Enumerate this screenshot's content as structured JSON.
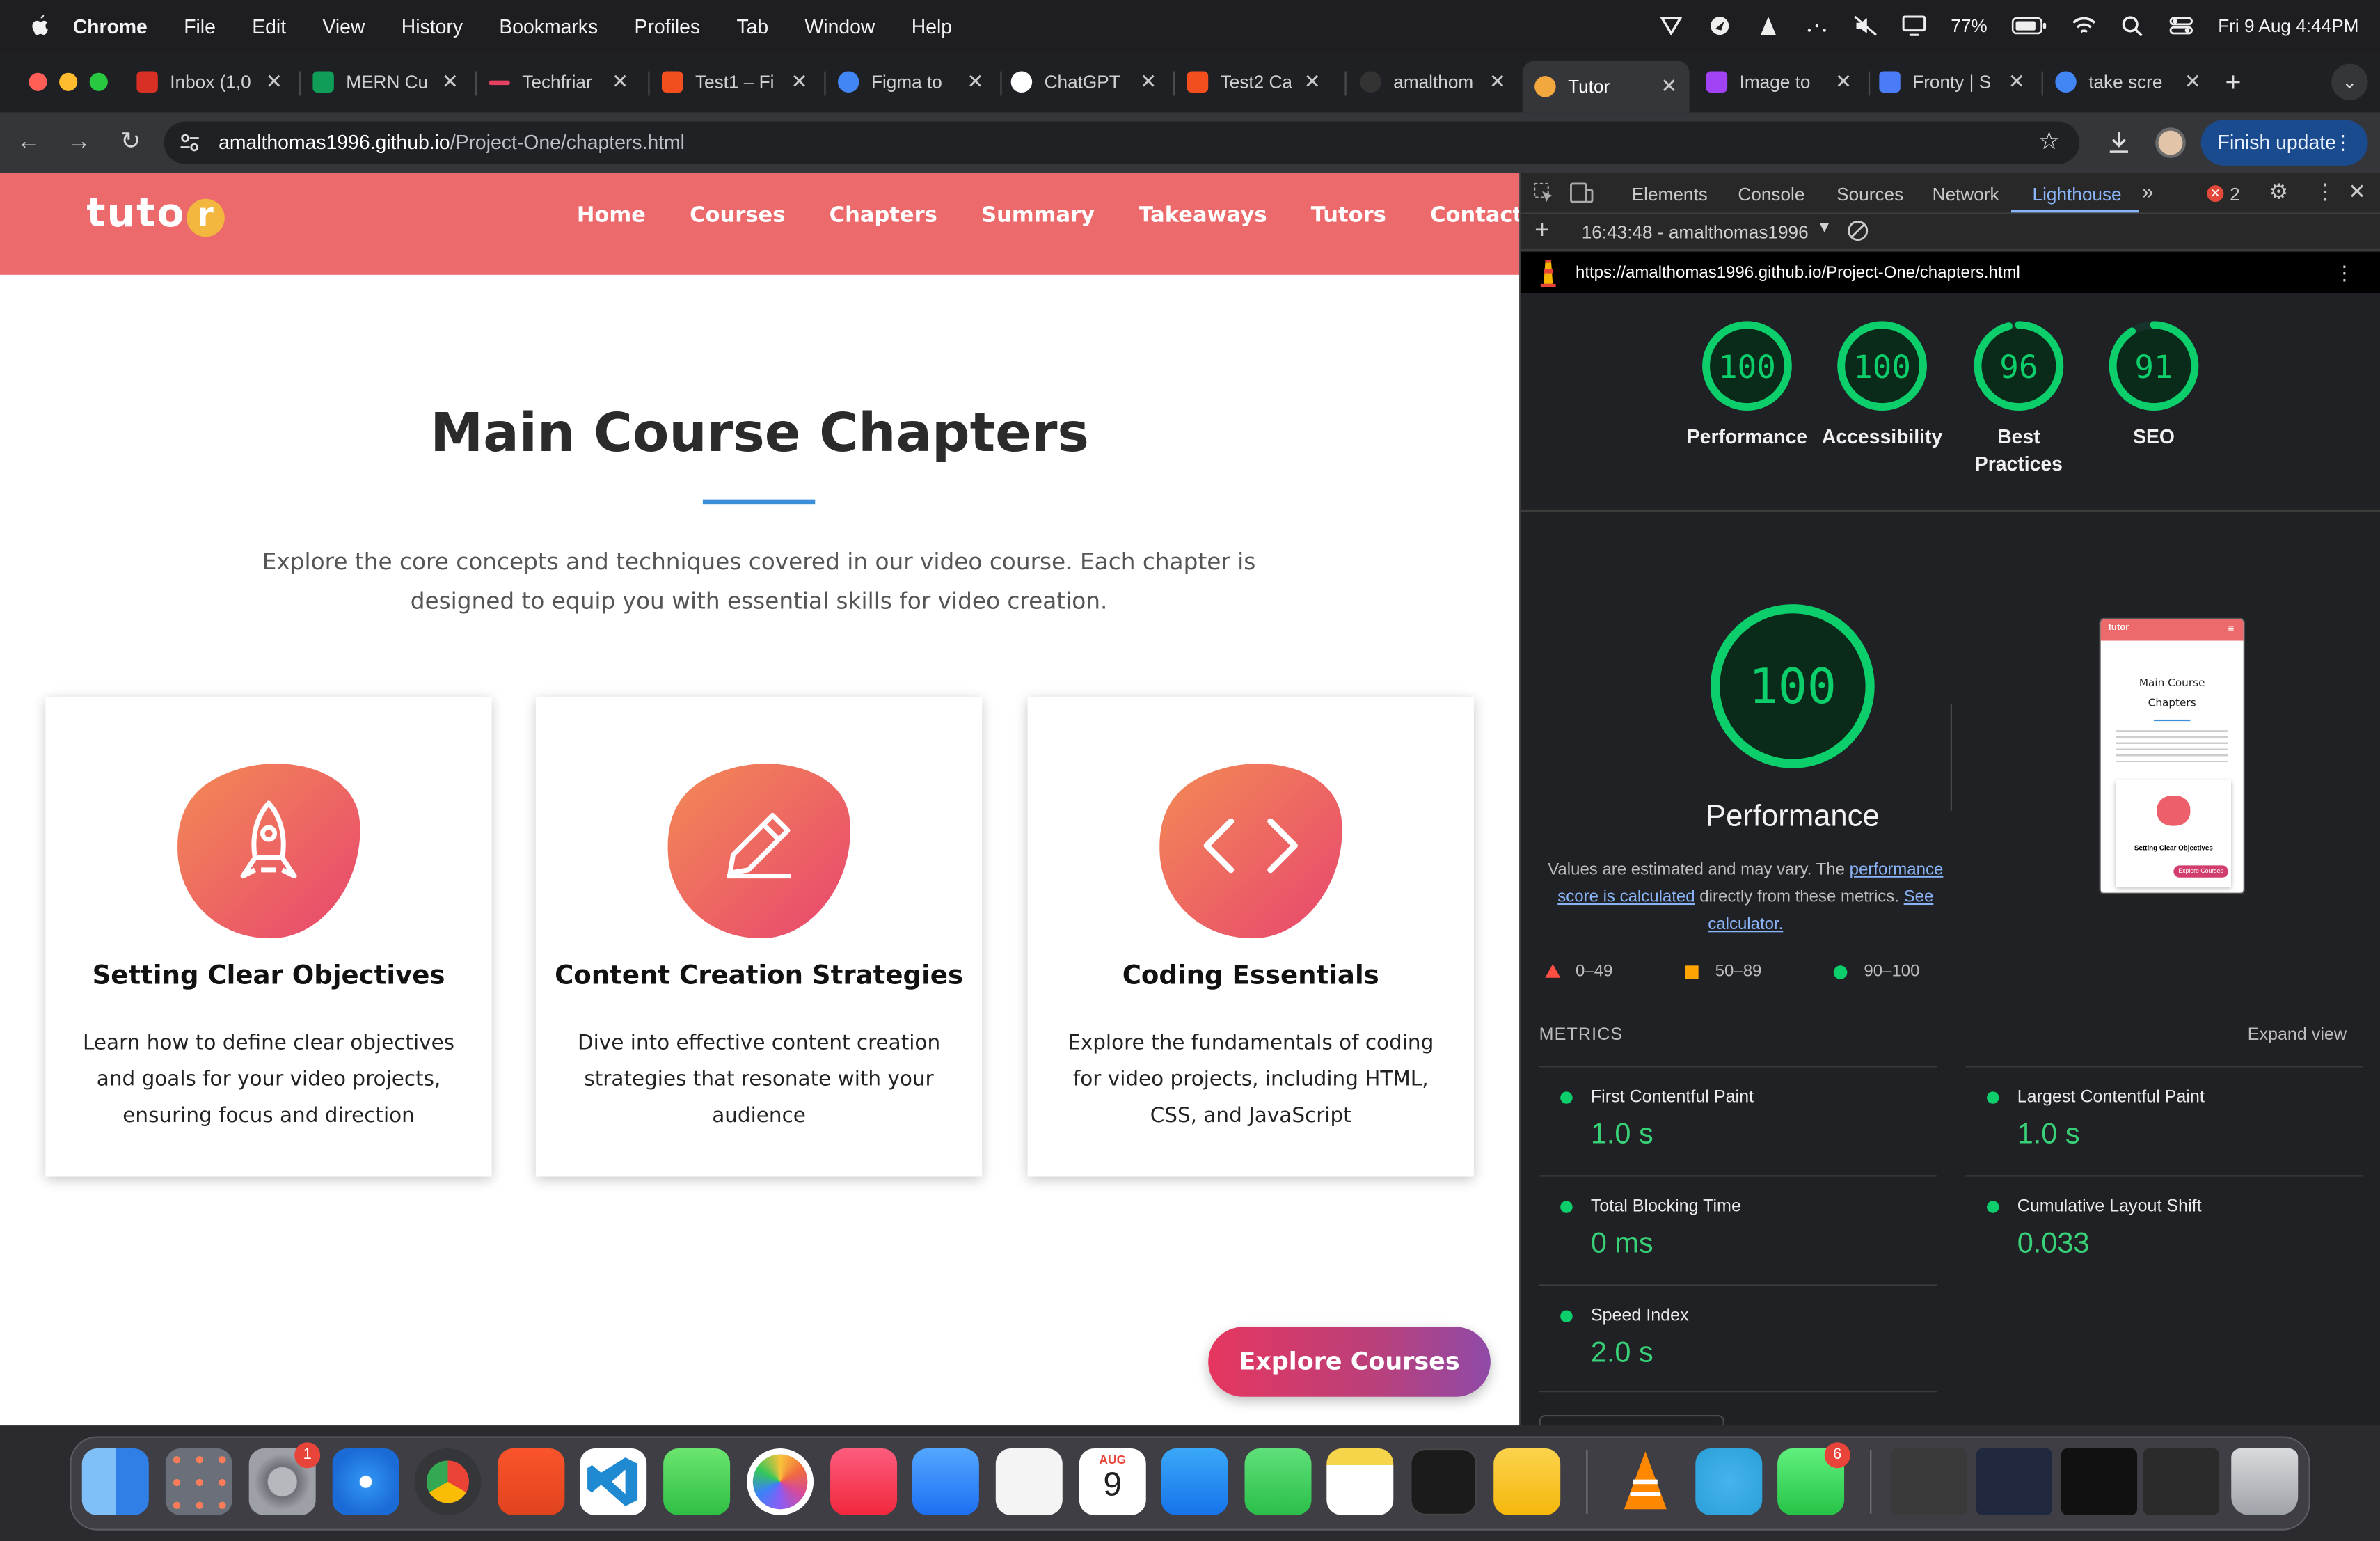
{
  "menubar": {
    "app": "Chrome",
    "items": [
      "File",
      "Edit",
      "View",
      "History",
      "Bookmarks",
      "Profiles",
      "Tab",
      "Window",
      "Help"
    ],
    "battery": "77%",
    "datetime": "Fri 9 Aug  4:44PM"
  },
  "tabs": [
    {
      "label": "Inbox (1,0",
      "color": "#d93025"
    },
    {
      "label": "MERN Cu",
      "color": "#0f9d58"
    },
    {
      "label": "Techfriar",
      "color": "#e4405f"
    },
    {
      "label": "Test1 – Fi",
      "color": "#f24e1e"
    },
    {
      "label": "Figma to",
      "color": "#4285f4"
    },
    {
      "label": "ChatGPT",
      "color": "#ffffff"
    },
    {
      "label": "Test2 Ca",
      "color": "#f24e1e"
    },
    {
      "label": "amalthom",
      "color": "#333333"
    },
    {
      "label": "Tutor",
      "color": "#f3a73f"
    },
    {
      "label": "Image to",
      "color": "#a142f4"
    },
    {
      "label": "Fronty | S",
      "color": "#4a7cf7"
    },
    {
      "label": "take scre",
      "color": "#4285f4"
    }
  ],
  "browser": {
    "url_host": "amalthomas1996.github.io",
    "url_path": "/Project-One/chapters.html",
    "finish_update": "Finish update"
  },
  "site": {
    "logo_main": "tuto",
    "logo_letter": "r",
    "nav": [
      "Home",
      "Courses",
      "Chapters",
      "Summary",
      "Takeaways",
      "Tutors",
      "Contact"
    ],
    "heading": "Main Course Chapters",
    "lead": "Explore the core concepts and techniques covered in our video course. Each chapter is designed to equip you with essential skills for video creation.",
    "cards": [
      {
        "title": "Setting Clear Objectives",
        "desc": "Learn how to define clear objectives and goals for your video projects, ensuring focus and direction",
        "icon": "rocket-icon"
      },
      {
        "title": "Content Creation Strategies",
        "desc": "Dive into effective content creation strategies that resonate with your audience",
        "icon": "pencil-icon"
      },
      {
        "title": "Coding Essentials",
        "desc": "Explore the fundamentals of coding for video projects, including HTML, CSS, and JavaScript",
        "icon": "code-icon"
      }
    ],
    "cta": "Explore Courses"
  },
  "devtools": {
    "tabs": [
      "Elements",
      "Console",
      "Sources",
      "Network",
      "Lighthouse"
    ],
    "errors": "2",
    "report_time": "16:43:48 - amalthomas1996",
    "report_url": "https://amalthomas1996.github.io/Project-One/chapters.html",
    "scores": [
      {
        "label": "Performance",
        "value": 100
      },
      {
        "label": "Accessibility",
        "value": 100
      },
      {
        "label": "Best Practices",
        "value": 96
      },
      {
        "label": "SEO",
        "value": 91
      }
    ],
    "big_score": 100,
    "big_label": "Performance",
    "note_pre": "Values are estimated and may vary. The",
    "note_link1": "performance score is calculated",
    "note_mid": "directly from these metrics.",
    "note_link2": "See calculator.",
    "legend": [
      "0–49",
      "50–89",
      "90–100"
    ],
    "metrics_title": "METRICS",
    "expand": "Expand view",
    "metrics": [
      {
        "label": "First Contentful Paint",
        "value": "1.0 s"
      },
      {
        "label": "Largest Contentful Paint",
        "value": "1.0 s"
      },
      {
        "label": "Total Blocking Time",
        "value": "0 ms"
      },
      {
        "label": "Cumulative Layout Shift",
        "value": "0.033"
      },
      {
        "label": "Speed Index",
        "value": "2.0 s"
      }
    ],
    "thumb": {
      "logo": "tutor",
      "heading": "Main Course Chapters",
      "card_title": "Setting Clear Objectives",
      "cta": "Explore Courses"
    },
    "pass_color": "#0cce6b"
  },
  "dock": {
    "badges": {
      "settings": "1",
      "whatsapp": "6"
    },
    "calendar_month": "AUG",
    "calendar_day": "9"
  }
}
